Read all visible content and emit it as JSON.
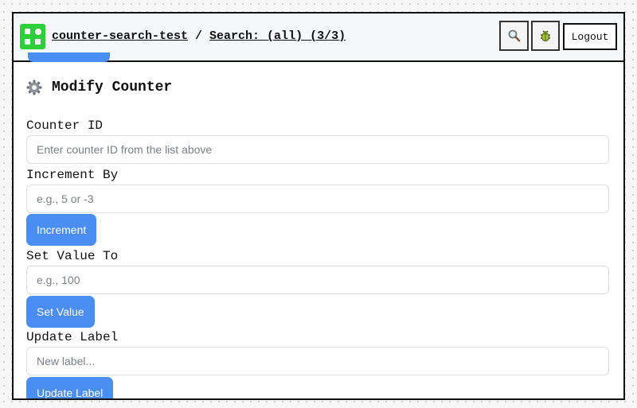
{
  "header": {
    "project_link": "counter-search-test",
    "separator": "/",
    "search_link": "Search: (all) (3/3)",
    "search_icon": "magnifier-icon",
    "debug_icon": "bug-icon",
    "logout_label": "Logout"
  },
  "modify": {
    "title": "Modify Counter",
    "title_icon": "gear-icon",
    "counter_id_label": "Counter ID",
    "counter_id_placeholder": "Enter counter ID from the list above",
    "increment_by_label": "Increment By",
    "increment_by_placeholder": "e.g., 5 or -3",
    "increment_button": "Increment",
    "set_value_label": "Set Value To",
    "set_value_placeholder": "e.g., 100",
    "set_value_button": "Set Value",
    "update_label_label": "Update Label",
    "update_label_placeholder": "New label...",
    "update_label_button": "Update Label"
  },
  "colors": {
    "logo": "#2fcf3c",
    "button": "#4a8df3",
    "border": "#111111"
  }
}
